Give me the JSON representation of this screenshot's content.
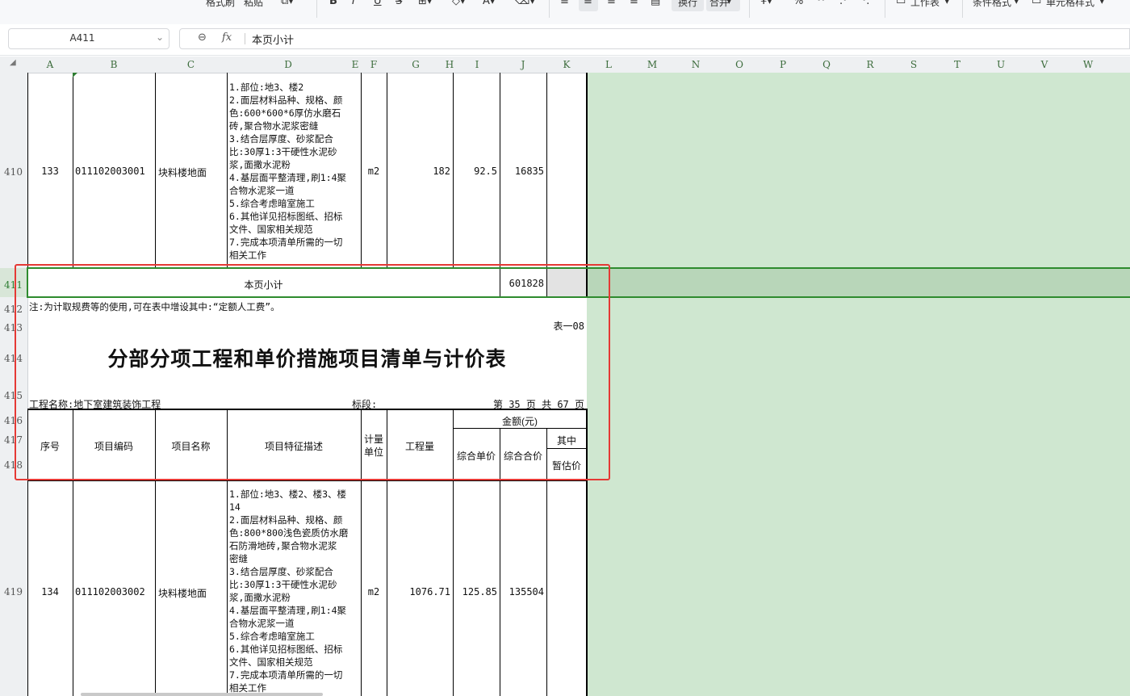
{
  "toolbar": {
    "items": [
      "格式刷",
      "粘贴",
      "B",
      "I",
      "U",
      "换行",
      "合并",
      "%",
      "工作表",
      "条件格式",
      "单元格样式"
    ]
  },
  "formula_bar": {
    "cell_ref": "A411",
    "fx": "fx",
    "content": "本页小计"
  },
  "columns": [
    "A",
    "B",
    "C",
    "D",
    "E",
    "F",
    "G",
    "H",
    "I",
    "J",
    "K",
    "L",
    "M",
    "N",
    "O",
    "P",
    "Q",
    "R",
    "S",
    "T",
    "U",
    "V",
    "W"
  ],
  "rows": [
    "410",
    "411",
    "412",
    "413",
    "414",
    "415",
    "416",
    "417",
    "418",
    "419"
  ],
  "item133": {
    "seq": "133",
    "code": "011102003001",
    "name": "块料楼地面",
    "desc": [
      "1.部位:地3、楼2",
      "2.面层材料品种、规格、颜",
      "色:600*600*6厚仿水磨石",
      "砖,聚合物水泥浆密缝",
      "3.结合层厚度、砂浆配合",
      "比:30厚1:3干硬性水泥砂",
      "浆,面撒水泥粉",
      "4.基层面平整清理,刷1:4聚",
      "合物水泥浆一道",
      "5.综合考虑暗室施工",
      "6.其他详见招标图纸、招标",
      "文件、国家相关规范",
      "7.完成本项清单所需的一切",
      "相关工作"
    ],
    "unit": "m2",
    "qty": "182",
    "price": "92.5",
    "total": "16835"
  },
  "subtotal": {
    "label": "本页小计",
    "value": "601828"
  },
  "note": "注:为计取规费等的使用,可在表中增设其中:“定额人工费”。",
  "table_no": "表一08",
  "title": "分部分项工程和单价措施项目清单与计价表",
  "project": {
    "label": "工程名称:地下室建筑装饰工程",
    "section": "标段:",
    "page": "第 35 页  共 67 页"
  },
  "headers": {
    "seq": "序号",
    "code": "项目编码",
    "name": "项目名称",
    "desc": "项目特征描述",
    "unit1": "计量",
    "unit2": "单位",
    "qty": "工程量",
    "amount": "金额(元)",
    "price": "综合单价",
    "total": "综合合价",
    "of_which": "其中",
    "provisional": "暂估价"
  },
  "item134": {
    "seq": "134",
    "code": "011102003002",
    "name": "块料楼地面",
    "desc": [
      "1.部位:地3、楼2、楼3、楼",
      "14",
      "2.面层材料品种、规格、颜",
      "色:800*800浅色瓷质仿水磨",
      "石防滑地砖,聚合物水泥浆",
      "密缝",
      "3.结合层厚度、砂浆配合",
      "比:30厚1:3干硬性水泥砂",
      "浆,面撒水泥粉",
      "4.基层面平整清理,刷1:4聚",
      "合物水泥浆一道",
      "5.综合考虑暗室施工",
      "6.其他详见招标图纸、招标",
      "文件、国家相关规范",
      "7.完成本项清单所需的一切",
      "相关工作"
    ],
    "unit": "m2",
    "qty": "1076.71",
    "price": "125.85",
    "total": "135504"
  },
  "colors": {
    "accent_green": "#2e8b2e",
    "highlight_red": "#e53935",
    "sheet_green": "#cfe7d0"
  }
}
